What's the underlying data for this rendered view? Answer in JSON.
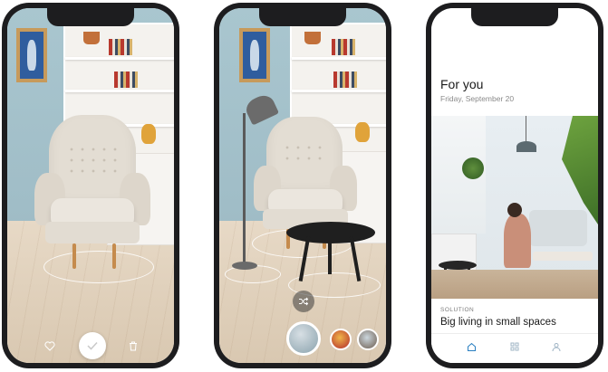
{
  "phone1": {
    "controls": {
      "favorite_icon": "heart-icon",
      "confirm_icon": "check-icon",
      "delete_icon": "trash-icon"
    }
  },
  "phone2": {
    "controls": {
      "shuffle_icon": "shuffle-icon",
      "swatches": [
        "product-swatch-selected",
        "product-swatch-2",
        "product-swatch-3"
      ]
    }
  },
  "phone3": {
    "feed": {
      "title": "For you",
      "date": "Friday, September 20",
      "card_label": "SOLUTION",
      "card_heading": "Big living in small spaces"
    },
    "tabs": [
      "home-icon",
      "grid-icon",
      "profile-icon"
    ],
    "colors": {
      "active_tab": "#2a7fc1",
      "inactive_tab": "#9fb4c4"
    }
  }
}
